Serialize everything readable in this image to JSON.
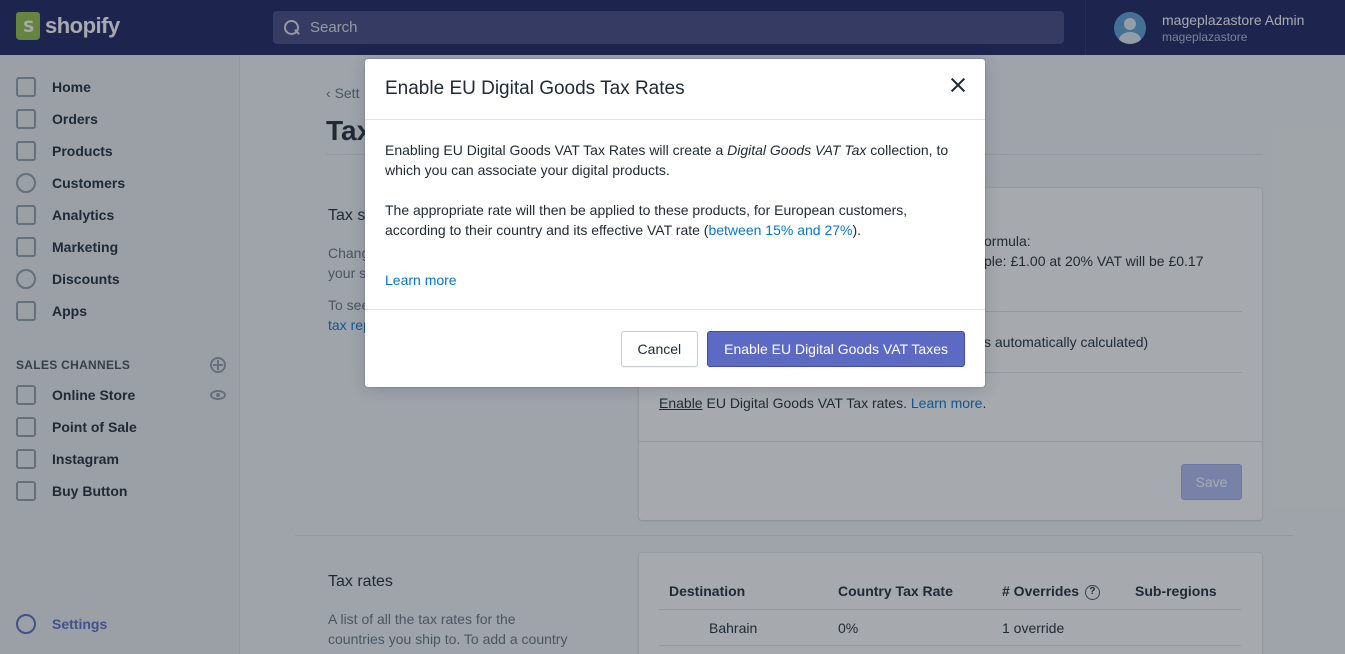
{
  "topbar": {
    "logo_text": "shopify",
    "search_placeholder": "Search",
    "user_name": "mageplazastore Admin",
    "user_store": "mageplazastore"
  },
  "sidebar": {
    "items": [
      {
        "label": "Home",
        "icon": "home-icon"
      },
      {
        "label": "Orders",
        "icon": "orders-icon"
      },
      {
        "label": "Products",
        "icon": "tag-icon"
      },
      {
        "label": "Customers",
        "icon": "customer-icon"
      },
      {
        "label": "Analytics",
        "icon": "analytics-icon"
      },
      {
        "label": "Marketing",
        "icon": "megaphone-icon"
      },
      {
        "label": "Discounts",
        "icon": "discount-icon"
      },
      {
        "label": "Apps",
        "icon": "apps-icon"
      }
    ],
    "channels_heading": "SALES CHANNELS",
    "channels": [
      {
        "label": "Online Store",
        "icon": "store-icon"
      },
      {
        "label": "Point of Sale",
        "icon": "shopify-bag-icon"
      },
      {
        "label": "Instagram",
        "icon": "instagram-icon"
      },
      {
        "label": "Buy Button",
        "icon": "shopify-bag-icon"
      }
    ],
    "settings_label": "Settings"
  },
  "background": {
    "back_label": "Sett",
    "page_title": "Tax",
    "tax_settings_title": "Tax s",
    "tax_settings_text_1a": "Chang",
    "tax_settings_text_1b": "your s",
    "tax_settings_text_2a": "To see",
    "tax_settings_text_2b": "tax rep",
    "card_line_1": "ormula:",
    "card_line_2": "ple: £1.00 at 20% VAT will be £0.17",
    "card_line_3": "s automatically calculated)",
    "enable_link": "Enable",
    "enable_text": " EU Digital Goods VAT Tax rates. ",
    "learn_more": "Learn more",
    "learn_more_suffix": ".",
    "save_label": "Save",
    "tax_rates_title": "Tax rates",
    "tax_rates_text_1": "A list of all the tax rates for the",
    "tax_rates_text_2": "countries you ship to. To add a country",
    "table_headers": [
      "Destination",
      "Country Tax Rate",
      "# Overrides",
      "Sub-regions"
    ],
    "table_row": {
      "destination": "Bahrain",
      "rate": "0%",
      "overrides": "1 override"
    },
    "help_glyph": "?"
  },
  "modal": {
    "title": "Enable EU Digital Goods Tax Rates",
    "p1_before": "Enabling EU Digital Goods VAT Tax Rates will create a ",
    "p1_italic": "Digital Goods VAT Tax",
    "p1_after": " collection, to which you can associate your digital products.",
    "p2_before": "The appropriate rate will then be applied to these products, for European customers, according to their country and its effective VAT rate (",
    "p2_link": "between 15% and 27%",
    "p2_after": ").",
    "learn_more": "Learn more",
    "cancel_label": "Cancel",
    "confirm_label": "Enable EU Digital Goods VAT Taxes"
  },
  "colors": {
    "topbar": "#1c2260",
    "primary": "#5c6ac4",
    "link": "#007ace"
  }
}
